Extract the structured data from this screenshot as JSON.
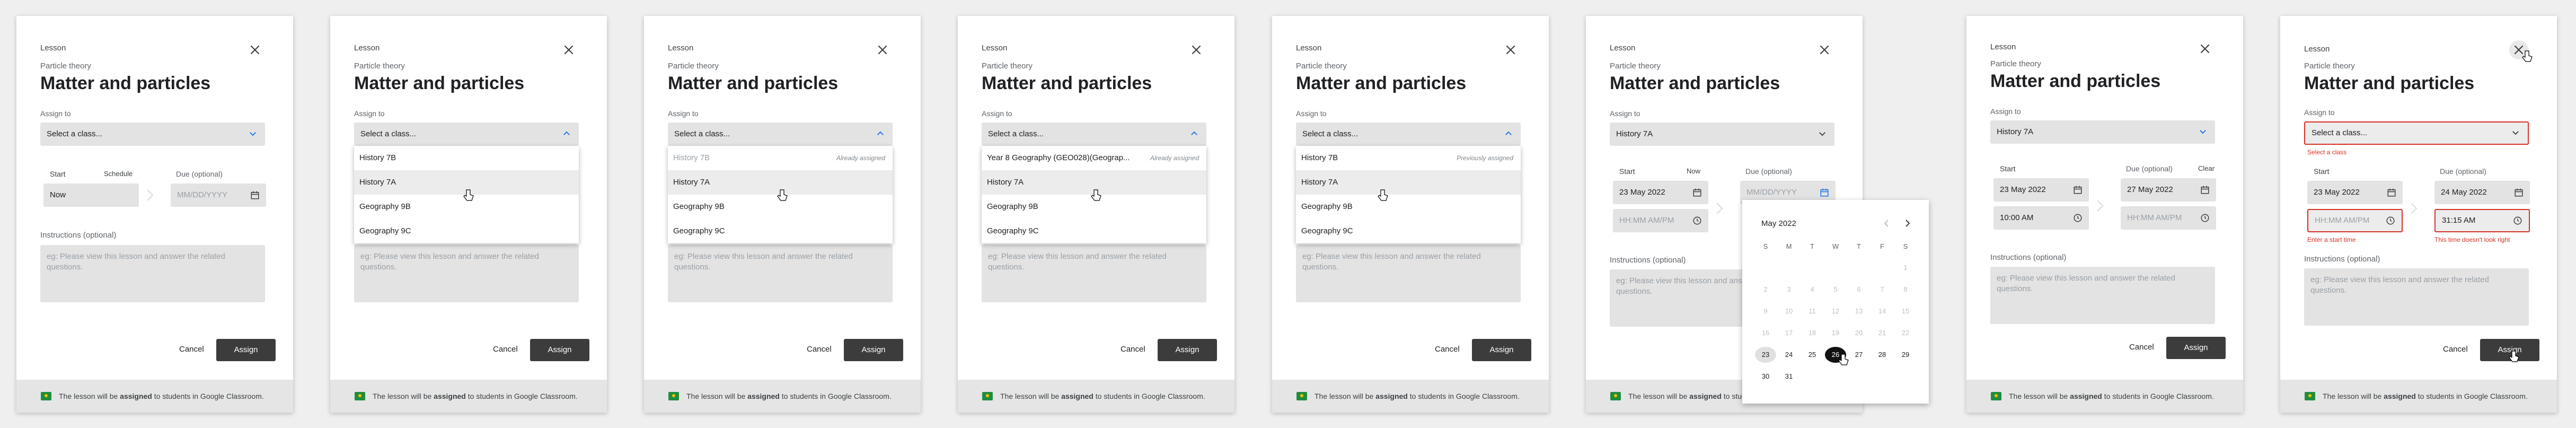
{
  "common": {
    "lesson_label": "Lesson",
    "subtitle": "Particle theory",
    "title": "Matter and particles",
    "assign_to_label": "Assign to",
    "select_placeholder": "Select a class...",
    "start_label": "Start",
    "due_label": "Due (optional)",
    "date_placeholder": "MM/DD/YYYY",
    "time_placeholder": "HH:MM AM/PM",
    "instructions_label": "Instructions (optional)",
    "instructions_placeholder": "eg: Please view this lesson and answer the related questions.",
    "cancel_label": "Cancel",
    "assign_label": "Assign",
    "footer_prefix": "The lesson will be ",
    "footer_bold": "assigned",
    "footer_suffix": " to students in Google Classroom."
  },
  "panel1": {
    "schedule_label": "Schedule",
    "start_value": "Now"
  },
  "panel2": {
    "options": [
      "History 7B",
      "History 7A",
      "Geography 9B",
      "Geography 9C"
    ]
  },
  "panel3": {
    "options": [
      "History 7B",
      "History 7A",
      "Geography 9B",
      "Geography 9C"
    ],
    "tag": "Already assigned"
  },
  "panel4": {
    "options": [
      "Year 8 Geography (GEO028)(Geograp...",
      "History 7A",
      "Geography 9B",
      "Geography 9C"
    ],
    "tag": "Already assigned"
  },
  "panel5": {
    "options": [
      "History 7B",
      "History 7A",
      "Geography 9B",
      "Geography 9C"
    ],
    "tag": "Previously assigned"
  },
  "panel6": {
    "selected_class": "History 7A",
    "now_label": "Now",
    "start_date": "23 May 2022",
    "calendar": {
      "month": "May 2022",
      "weekdays": [
        "S",
        "M",
        "T",
        "W",
        "T",
        "F",
        "S"
      ],
      "weeks": [
        [
          "",
          "",
          "",
          "",
          "",
          "",
          "1"
        ],
        [
          "2",
          "3",
          "4",
          "5",
          "6",
          "7",
          "8"
        ],
        [
          "9",
          "10",
          "11",
          "12",
          "13",
          "14",
          "15"
        ],
        [
          "16",
          "17",
          "18",
          "19",
          "20",
          "21",
          "22"
        ],
        [
          "23",
          "24",
          "25",
          "26",
          "27",
          "28",
          "29"
        ],
        [
          "30",
          "31",
          "",
          "",
          "",
          "",
          ""
        ]
      ],
      "today": "23",
      "selected": "26"
    }
  },
  "panel7": {
    "selected_class": "History 7A",
    "clear_label": "Clear",
    "start_date": "23 May 2022",
    "start_time": "10:00 AM",
    "due_date": "27 May 2022"
  },
  "panel8": {
    "class_error": "Select a class",
    "due_date": "24 May 2022",
    "start_date": "23 May 2022",
    "due_time": "31:15 AM",
    "start_time_error": "Enter a start time",
    "due_time_error": "This time doesn't look right"
  }
}
